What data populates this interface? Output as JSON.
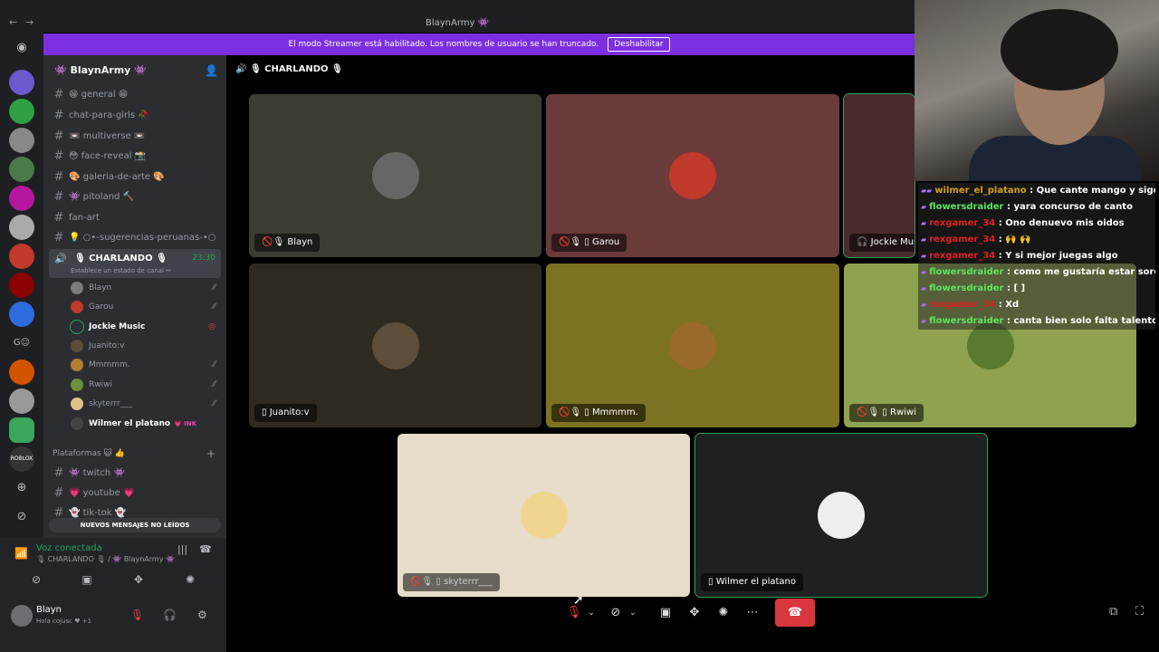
{
  "window": {
    "title": "BlaynArmy 👾",
    "back": "←",
    "forward": "→"
  },
  "banner": {
    "text": "El modo Streamer está habilitado. Los nombres de usuario se han truncado.",
    "button": "Deshabilitar"
  },
  "server": {
    "name": "👾 BlaynArmy 👾"
  },
  "channels": [
    {
      "label": "😁 general 😁"
    },
    {
      "label": "chat-para-girls 🥀"
    },
    {
      "label": "📼 multiverse 📼"
    },
    {
      "label": "😳 face-reveal 📸"
    },
    {
      "label": "🎨 galeria-de-arte 🎨"
    },
    {
      "label": "👾 pitoland 🔨"
    },
    {
      "label": "fan-art"
    },
    {
      "label": "💡 ○•-sugerencias-peruanas-•○"
    }
  ],
  "voice_channel": {
    "name": "🎙 CHARLANDO 🎙",
    "status": "Establece un estado de canal ✏",
    "time": "23:30"
  },
  "members": [
    {
      "name": "Blayn",
      "color": "#7a7d80"
    },
    {
      "name": "Garou",
      "color": "#c0392b"
    },
    {
      "name": "Jockie Music",
      "color": "#2c2f33"
    },
    {
      "name": "Juanito:v",
      "color": "#5d4e3a"
    },
    {
      "name": "Mmmmm.",
      "color": "#b08030"
    },
    {
      "name": "Rwiwi",
      "color": "#6d8f3c"
    },
    {
      "name": "skyterrr___",
      "color": "#e0c28a"
    },
    {
      "name": "Wilmer el platano",
      "color": "#444"
    }
  ],
  "wilmer_badge": "💗 INK",
  "category": {
    "name": "Plataformas 😺 👍"
  },
  "channels2": [
    {
      "label": "👾 twitch 👾"
    },
    {
      "label": "💗 youtube 💗"
    },
    {
      "label": "👻 tik-tok 👻"
    }
  ],
  "new_messages": "NUEVOS MENSAJES NO LEÍDOS",
  "voice_panel": {
    "status": "Voz conectada",
    "location": "🎙 CHARLANDO 🎙 / 👾 BlaynArmy 👾"
  },
  "user": {
    "name": "Blayn",
    "status": "Hola cojusc ♥ +1"
  },
  "stage": {
    "title": "🎙 CHARLANDO 🎙"
  },
  "tiles": [
    {
      "label": "Blayn",
      "prefix": "🚫🎙",
      "bg": "#3d3c33",
      "av": "#666"
    },
    {
      "label": "Garou",
      "prefix": "🚫🎙 ▯",
      "bg": "#6b3a3a",
      "av": "#c0392b"
    },
    {
      "label": "Jockie Music",
      "prefix": "🎧",
      "bg": "#4a2b2b",
      "av": "#2c2f33"
    },
    {
      "label": "Juanito:v",
      "prefix": "▯",
      "bg": "#2e2a20",
      "av": "#5d4e3a"
    },
    {
      "label": "Mmmmm.",
      "prefix": "🚫🎙 ▯",
      "bg": "#7b7222",
      "av": "#9a6a2a"
    },
    {
      "label": "Rwiwi",
      "prefix": "🚫🎙 ▯",
      "bg": "#8ea24f",
      "av": "#5a7a2f"
    },
    {
      "label": "skyterrr___",
      "prefix": "🚫🎙 ▯",
      "bg": "#e6dcc9",
      "av": "#f0d590"
    },
    {
      "label": "Wilmer el platano",
      "prefix": "▯",
      "bg": "#1f2021",
      "av": "#eee"
    }
  ],
  "chat": [
    {
      "name": "wilmer_el_platano",
      "color": "gold",
      "text": "Que cante mango y sigo yo"
    },
    {
      "name": "flowersdraider",
      "color": "green",
      "text": "yara concurso de canto"
    },
    {
      "name": "rexgamer_34",
      "color": "red",
      "text": "Ono denuevo mis oidos"
    },
    {
      "name": "rexgamer_34",
      "color": "red",
      "text": "🙌 🙌"
    },
    {
      "name": "rexgamer_34",
      "color": "red",
      "text": "Y si mejor juegas algo"
    },
    {
      "name": "flowersdraider",
      "color": "green",
      "text": "como me gustaría estar sorda"
    },
    {
      "name": "flowersdraider",
      "color": "green",
      "text": "[ ]"
    },
    {
      "name": "rexgamer_34",
      "color": "red",
      "text": "Xd"
    },
    {
      "name": "flowersdraider",
      "color": "green",
      "text": "canta bien solo falta talento"
    }
  ]
}
